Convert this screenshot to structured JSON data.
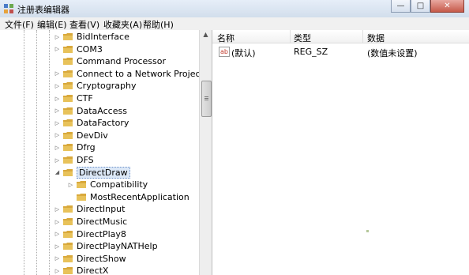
{
  "window": {
    "title": "注册表编辑器",
    "buttons": {
      "minimize": "—",
      "maximize": "□",
      "close": "✕"
    }
  },
  "menu": [
    "文件(F)",
    "编辑(E)",
    "查看(V)",
    "收藏夹(A)",
    "帮助(H)"
  ],
  "tree": [
    {
      "label": "BidInterface",
      "expander": "▷",
      "level": 0
    },
    {
      "label": "COM3",
      "expander": "▷",
      "level": 0
    },
    {
      "label": "Command Processor",
      "expander": "",
      "level": 0
    },
    {
      "label": "Connect to a Network Projector",
      "expander": "▷",
      "level": 0
    },
    {
      "label": "Cryptography",
      "expander": "▷",
      "level": 0
    },
    {
      "label": "CTF",
      "expander": "▷",
      "level": 0
    },
    {
      "label": "DataAccess",
      "expander": "▷",
      "level": 0
    },
    {
      "label": "DataFactory",
      "expander": "▷",
      "level": 0
    },
    {
      "label": "DevDiv",
      "expander": "▷",
      "level": 0
    },
    {
      "label": "Dfrg",
      "expander": "▷",
      "level": 0
    },
    {
      "label": "DFS",
      "expander": "▷",
      "level": 0
    },
    {
      "label": "DirectDraw",
      "expander": "◢",
      "level": 0,
      "selected": true
    },
    {
      "label": "Compatibility",
      "expander": "▷",
      "level": 1
    },
    {
      "label": "MostRecentApplication",
      "expander": "",
      "level": 1
    },
    {
      "label": "DirectInput",
      "expander": "▷",
      "level": 0
    },
    {
      "label": "DirectMusic",
      "expander": "▷",
      "level": 0
    },
    {
      "label": "DirectPlay8",
      "expander": "▷",
      "level": 0
    },
    {
      "label": "DirectPlayNATHelp",
      "expander": "▷",
      "level": 0
    },
    {
      "label": "DirectShow",
      "expander": "▷",
      "level": 0
    },
    {
      "label": "DirectX",
      "expander": "▷",
      "level": 0
    }
  ],
  "list": {
    "columns": [
      "名称",
      "类型",
      "数据"
    ],
    "rows": [
      {
        "icon": "ab",
        "name": "(默认)",
        "type": "REG_SZ",
        "data": "(数值未设置)"
      }
    ]
  },
  "colors": {
    "folder": "#e8c25a",
    "selection": "#dce8f7",
    "titlebar": "#dbe6f3"
  },
  "icons": {
    "app": "registry-editor-icon",
    "folder": "folder-icon",
    "value": "string-value-icon",
    "expander": "chevron-right-icon"
  }
}
